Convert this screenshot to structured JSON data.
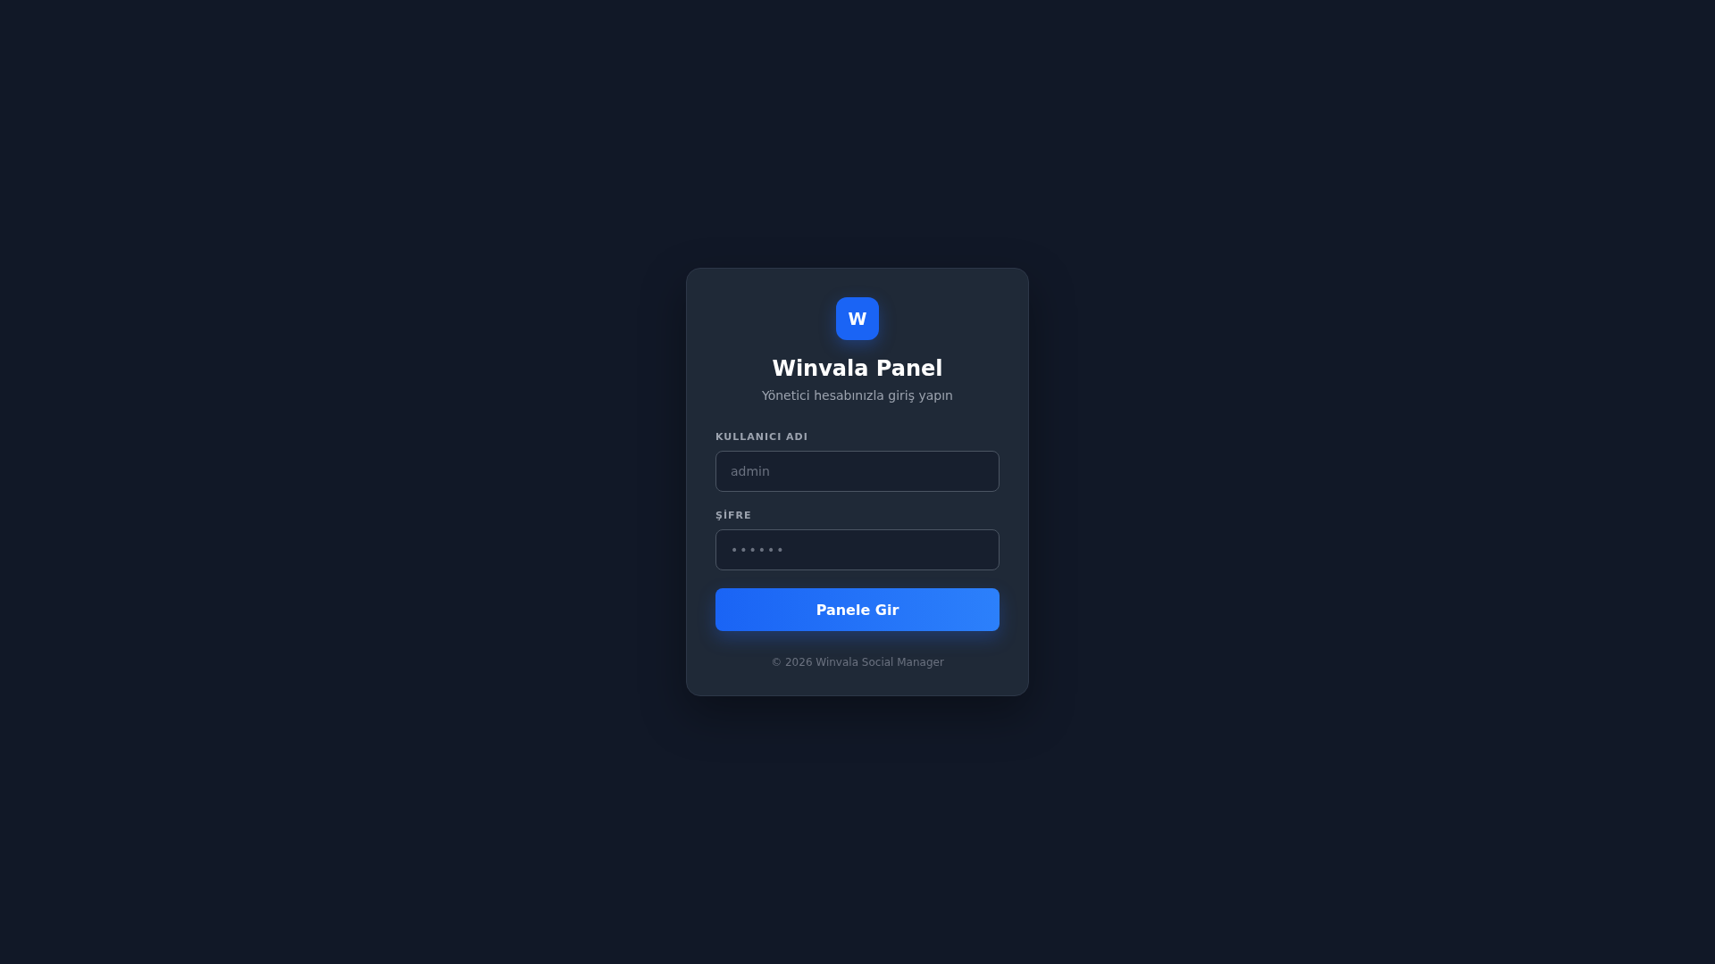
{
  "logo": {
    "letter": "W"
  },
  "title": "Winvala Panel",
  "subtitle": "Yönetici hesabınızla giriş yapın",
  "fields": [
    {
      "label": "KULLANICI ADI",
      "placeholder": "admin",
      "kind": "text"
    },
    {
      "label": "ŞİFRE",
      "placeholder": "••••••",
      "kind": "password"
    }
  ],
  "button": "Panele Gir",
  "footer": "© 2026 Winvala Social Manager"
}
